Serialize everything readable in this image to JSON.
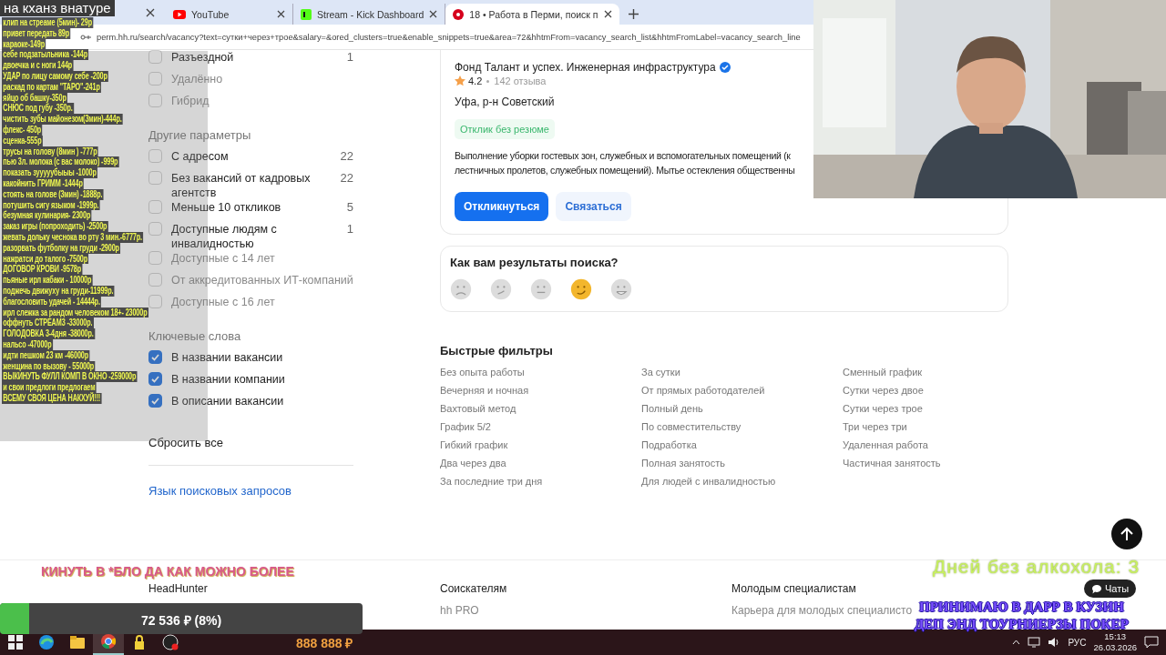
{
  "browser": {
    "tabs": [
      {
        "title": "YouTube",
        "selected": false
      },
      {
        "title": "Stream - Kick Dashboard",
        "selected": false
      },
      {
        "title": "18 • Работа в Перми, поиск п",
        "selected": true
      }
    ],
    "url": "perm.hh.ru/search/vacancy?text=сутки+через+трое&salary=&ored_clusters=true&enable_snippets=true&area=72&hhtmFrom=vacancy_search_list&hhtmFromLabel=vacancy_search_line"
  },
  "filters": {
    "groups": [
      {
        "items": [
          {
            "label": "Разъездной",
            "count": "1",
            "checked": false,
            "disabled": false
          },
          {
            "label": "Удалённо",
            "checked": false,
            "disabled": true
          },
          {
            "label": "Гибрид",
            "checked": false,
            "disabled": true
          }
        ]
      },
      {
        "title": "Другие параметры",
        "items": [
          {
            "label": "С адресом",
            "count": "22",
            "checked": false,
            "disabled": false
          },
          {
            "label": "Без вакансий от кадровых агентств",
            "count": "22",
            "checked": false,
            "disabled": false
          },
          {
            "label": "Меньше 10 откликов",
            "count": "5",
            "checked": false,
            "disabled": false
          },
          {
            "label": "Доступные людям с инвалидностью",
            "count": "1",
            "checked": false,
            "disabled": false
          },
          {
            "label": "Доступные с 14 лет",
            "checked": false,
            "disabled": true
          },
          {
            "label": "От аккредитованных ИТ-компаний",
            "checked": false,
            "disabled": true
          },
          {
            "label": "Доступные с 16 лет",
            "checked": false,
            "disabled": true
          }
        ]
      },
      {
        "title": "Ключевые слова",
        "items": [
          {
            "label": "В названии вакансии",
            "checked": true,
            "disabled": false
          },
          {
            "label": "В названии компании",
            "checked": true,
            "disabled": false
          },
          {
            "label": "В описании вакансии",
            "checked": true,
            "disabled": false
          }
        ]
      }
    ],
    "reset": "Сбросить все",
    "language_link": "Язык поисковых запросов"
  },
  "vacancy": {
    "company": "Фонд Талант и успех. Инженерная инфраструктура",
    "rating": "4.2",
    "reviews": "142 отзыва",
    "location": "Уфа, р-н Советский",
    "tag": "Отклик без резюме",
    "description": [
      "Выполнение уборки гостевых зон, служебных и вспомогательных помещений (к",
      "лестничных пролетов, служебных помещений). Мытье остекления общественны"
    ],
    "buttons": [
      "Откликнуться",
      "Связаться"
    ]
  },
  "feedback": {
    "title": "Как вам результаты поиска?",
    "faces": [
      {
        "kind": "sad",
        "selected": false
      },
      {
        "kind": "confused",
        "selected": false
      },
      {
        "kind": "neutral",
        "selected": false
      },
      {
        "kind": "smile",
        "selected": true
      },
      {
        "kind": "grin",
        "selected": false
      }
    ]
  },
  "quick_filters": {
    "title": "Быстрые фильтры",
    "columns": [
      [
        "Без опыта работы",
        "Вечерняя и ночная",
        "Вахтовый метод",
        "График 5/2",
        "Гибкий график",
        "Два через два",
        "За последние три дня"
      ],
      [
        "За сутки",
        "От прямых работодателей",
        "Полный день",
        "По совместительству",
        "Подработка",
        "Полная занятость",
        "Для людей с инвалидностью"
      ],
      [
        "Сменный график",
        "Сутки через двое",
        "Сутки через трое",
        "Три через три",
        "Удаленная работа",
        "Частичная занятость"
      ]
    ]
  },
  "footer": {
    "columns": [
      {
        "title": "HeadHunter"
      },
      {
        "title": "Соискателям",
        "links": [
          "hh PRO"
        ]
      },
      {
        "title": "Молодым специалистам",
        "links": [
          "Карьера для молодых специалисто"
        ]
      }
    ],
    "chat": "Чаты"
  },
  "overlay": {
    "title": "на кханз внатуре",
    "donations": [
      "клип на стреаме (5мин)- 29р",
      "привет передать 89р",
      "караоке-149р",
      "себе подзатыльника -144р",
      "двоечка и с ноги 144р",
      "УДАР по лицу самому себе -200р",
      "раскад по картам \"ТАРО\"-241р",
      "яйцо об башку-350р",
      "СНЮС под губу -350р.",
      "чистить зубы майонезом(3мин)-444р.",
      "флекс- 450р",
      "сценка-555р",
      "трусы на голову (8мин ) -777р",
      "пью 3л. молока (с вас молоко) -999р",
      "показать зууууубыыы -1000р",
      "какойнить ГРИММ -1444р",
      "стоять на голове (3мин) -1888р.",
      "потушить сигу языком -1999р.",
      "безумная кулинария- 2300р",
      "заказ игры (попроходить) -2500р",
      "жевать дольку чеснока во рту 3 мин.-6777р.",
      "разорвать футболку на груди -2900р",
      "нажратси до талого -7500р",
      "ДОГОВОР КРОВИ -9578р",
      "пьяные ирл кабаки - 10000р",
      "поджечь движуху на груди-11999р.",
      "благословить удачей - 14444р.",
      "ирл слежка за рандом человеком 18+- 23000р",
      "оффнуть СТРЕАМ3 -33000р.",
      "ГОЛОДОВКА 3-4дня -38000р.",
      "нальсо -47000р",
      "идти пешком 23 км -46000р",
      "женщина по вызову - 55000р",
      "ВЫКИНУТЬ ФУЛЛ КОМП В ОКНО -259000р",
      "и свои предлоги предлогаем",
      "ВСЕМУ СВОЯ ЦЕНА НАКХУЙ!!!"
    ],
    "goal_title": "КИНУТЬ В *БЛО ДА КАК МОЖНО БОЛЕЕ",
    "goal": {
      "text": "72 536 ₽ (8%)",
      "level": 0.08
    },
    "sober": "Дней  без  алкохола: 3",
    "poker": [
      "ПРИНИМАЮ В ДАРР В КУЗИН",
      "ДЕП ЭНД ТОУРНИЕРЗЫ ПОКЕР"
    ],
    "counter": "888 888 ₽"
  },
  "taskbar": {
    "apps": [
      {
        "kind": "edge",
        "selected": false
      },
      {
        "kind": "folder",
        "selected": false
      },
      {
        "kind": "chrome",
        "selected": true
      },
      {
        "kind": "lock",
        "selected": false
      },
      {
        "kind": "obs",
        "selected": false
      }
    ],
    "language": "РУС",
    "time": "15:13",
    "date": "26.03.2026"
  }
}
